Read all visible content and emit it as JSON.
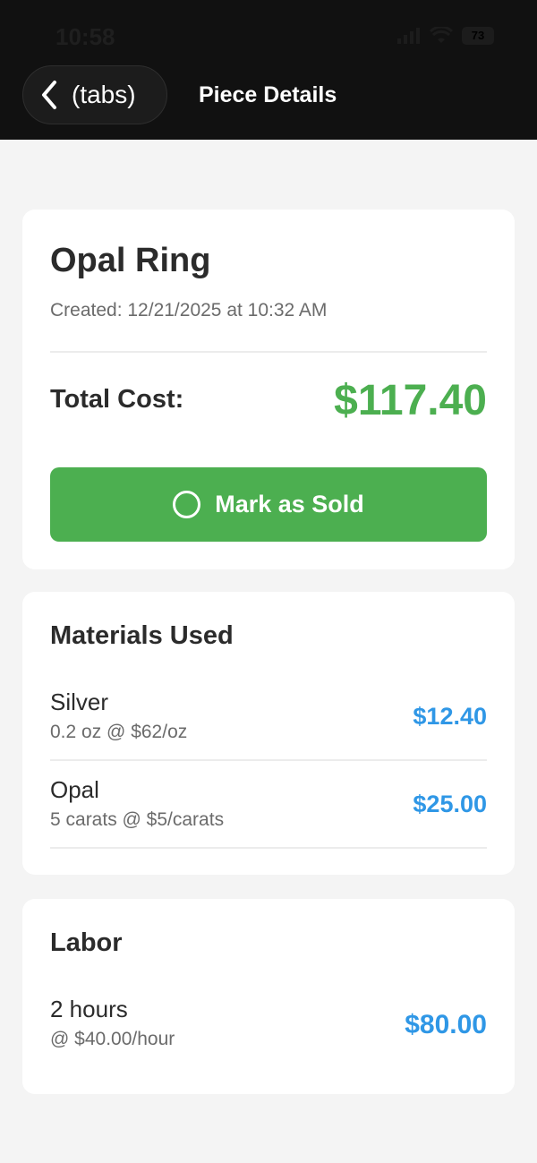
{
  "status_bar": {
    "time": "10:58",
    "battery": "73"
  },
  "nav": {
    "back_label": "(tabs)",
    "title": "Piece Details"
  },
  "piece": {
    "name": "Opal Ring",
    "created": "Created: 12/21/2025 at 10:32 AM",
    "total_label": "Total Cost:",
    "total_value": "$117.40",
    "sold_button_label": "Mark as Sold"
  },
  "materials": {
    "title": "Materials Used",
    "items": [
      {
        "name": "Silver",
        "detail": "0.2 oz @ $62/oz",
        "price": "$12.40"
      },
      {
        "name": "Opal",
        "detail": "5 carats @ $5/carats",
        "price": "$25.00"
      }
    ]
  },
  "labor": {
    "title": "Labor",
    "hours": "2 hours",
    "rate": "@ $40.00/hour",
    "price": "$80.00"
  },
  "colors": {
    "accent_green": "#4caf50",
    "accent_blue": "#2f97e6",
    "header_bg": "#111111"
  },
  "icons": {
    "back": "chevron-left-icon",
    "sold": "circle-icon",
    "signal": "signal-icon",
    "wifi": "wifi-icon",
    "battery": "battery-icon"
  }
}
